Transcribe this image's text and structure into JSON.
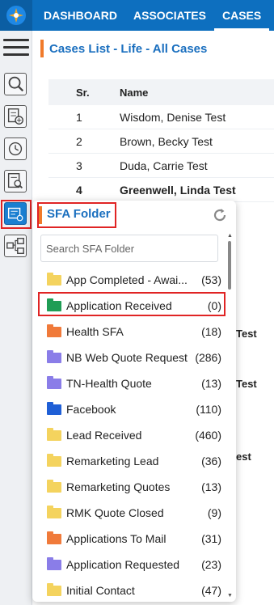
{
  "nav": {
    "items": [
      "DASHBOARD",
      "ASSOCIATES",
      "CASES"
    ]
  },
  "page": {
    "title": "Cases List - Life - All Cases"
  },
  "table": {
    "headers": {
      "sr": "Sr.",
      "name": "Name"
    },
    "rows": [
      {
        "sr": "1",
        "name": "Wisdom, Denise Test"
      },
      {
        "sr": "2",
        "name": "Brown, Becky Test"
      },
      {
        "sr": "3",
        "name": "Duda, Carrie Test"
      },
      {
        "sr": "4",
        "name": "Greenwell, Linda Test"
      }
    ],
    "partial_texts": [
      "Test",
      "Test",
      "est"
    ]
  },
  "popup": {
    "title": "SFA Folder",
    "search_placeholder": "Search SFA Folder",
    "folders": [
      {
        "name": "App Completed - Awai...",
        "count": "(53)",
        "color": "#f4d35e"
      },
      {
        "name": "Application Received",
        "count": "(0)",
        "color": "#1f9d55"
      },
      {
        "name": "Health SFA",
        "count": "(18)",
        "color": "#f07a3a"
      },
      {
        "name": "NB Web Quote Request",
        "count": "(286)",
        "color": "#8a7de8"
      },
      {
        "name": "TN-Health Quote",
        "count": "(13)",
        "color": "#8a7de8"
      },
      {
        "name": "Facebook",
        "count": "(110)",
        "color": "#1f5fd6"
      },
      {
        "name": "Lead Received",
        "count": "(460)",
        "color": "#f4d35e"
      },
      {
        "name": "Remarketing Lead",
        "count": "(36)",
        "color": "#f4d35e"
      },
      {
        "name": "Remarketing Quotes",
        "count": "(13)",
        "color": "#f4d35e"
      },
      {
        "name": "RMK Quote Closed",
        "count": "(9)",
        "color": "#f4d35e"
      },
      {
        "name": "Applications To Mail",
        "count": "(31)",
        "color": "#f07a3a"
      },
      {
        "name": "Application Requested",
        "count": "(23)",
        "color": "#8a7de8"
      },
      {
        "name": "Initial Contact",
        "count": "(47)",
        "color": "#f4d35e"
      }
    ]
  },
  "colors": {
    "brand": "#0d6fbf",
    "accent": "#f07a2a",
    "highlight": "#e02424"
  },
  "icons": [
    "logo-icon",
    "hamburger-icon",
    "search-doc-icon",
    "add-doc-icon",
    "history-icon",
    "doc-search-icon",
    "folder-tool-icon",
    "flow-icon",
    "refresh-icon"
  ]
}
